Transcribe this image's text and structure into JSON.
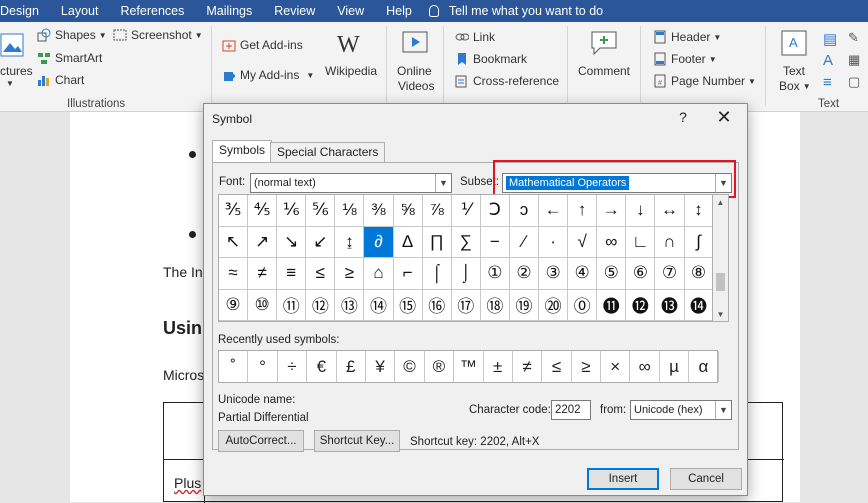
{
  "ribbon_tabs": [
    "Design",
    "Layout",
    "References",
    "Mailings",
    "Review",
    "View",
    "Help"
  ],
  "tell_me": "Tell me what you want to do",
  "ribbon": {
    "pictures": "ctures",
    "shapes": "Shapes",
    "smartart": "SmartArt",
    "chart": "Chart",
    "screenshot": "Screenshot",
    "illustrations": "Illustrations",
    "get_addins": "Get Add-ins",
    "my_addins": "My Add-ins",
    "wikipedia": "Wikipedia",
    "online_videos_1": "Online",
    "online_videos_2": "Videos",
    "link": "Link",
    "bookmark": "Bookmark",
    "cross_reference": "Cross-reference",
    "comment": "Comment",
    "header": "Header",
    "footer": "Footer",
    "page_number": "Page Number",
    "text_box_1": "Text",
    "text_box_2": "Box",
    "text_group": "Text"
  },
  "doc": {
    "line1": "The In",
    "heading": "Usin",
    "line3": "Micros",
    "table_text": "Plus"
  },
  "dialog": {
    "title": "Symbol",
    "help": "?",
    "close": "✕",
    "tabs": [
      "Symbols",
      "Special Characters"
    ],
    "font_label": "Font:",
    "font_value": "(normal text)",
    "subset_label": "Subset:",
    "subset_value": "Mathematical Operators",
    "symbols": [
      [
        "⅗",
        "⅘",
        "⅙",
        "⅚",
        "⅛",
        "⅜",
        "⅝",
        "⅞",
        "⅟",
        "Ↄ",
        "ↄ",
        "←",
        "↑",
        "→",
        "↓",
        "↔",
        "↕"
      ],
      [
        "↖",
        "↗",
        "↘",
        "↙",
        "↨",
        "∂",
        "∆",
        "∏",
        "∑",
        "−",
        "∕",
        "∙",
        "√",
        "∞",
        "∟",
        "∩",
        "∫"
      ],
      [
        "≈",
        "≠",
        "≡",
        "≤",
        "≥",
        "⌂",
        "⌐",
        "⌠",
        "⌡",
        "①",
        "②",
        "③",
        "④",
        "⑤",
        "⑥",
        "⑦",
        "⑧"
      ],
      [
        "⑨",
        "⑩",
        "⑪",
        "⑫",
        "⑬",
        "⑭",
        "⑮",
        "⑯",
        "⑰",
        "⑱",
        "⑲",
        "⑳",
        "⓪",
        "⓫",
        "⓬",
        "⓭",
        "⓮"
      ]
    ],
    "selected": [
      1,
      5
    ],
    "recent_label": "Recently used symbols:",
    "recent": [
      "˚",
      "°",
      "÷",
      "€",
      "£",
      "¥",
      "©",
      "®",
      "™",
      "±",
      "≠",
      "≤",
      "≥",
      "×",
      "∞",
      "µ",
      "α"
    ],
    "unicode_name_label": "Unicode name:",
    "unicode_name": "Partial Differential",
    "char_code_label": "Character code:",
    "char_code": "2202",
    "from_label": "from:",
    "from_value": "Unicode (hex)",
    "autocorrect": "AutoCorrect...",
    "shortcut_key_btn": "Shortcut Key...",
    "shortcut_key_text": "Shortcut key: 2202, Alt+X",
    "insert": "Insert",
    "cancel": "Cancel"
  }
}
